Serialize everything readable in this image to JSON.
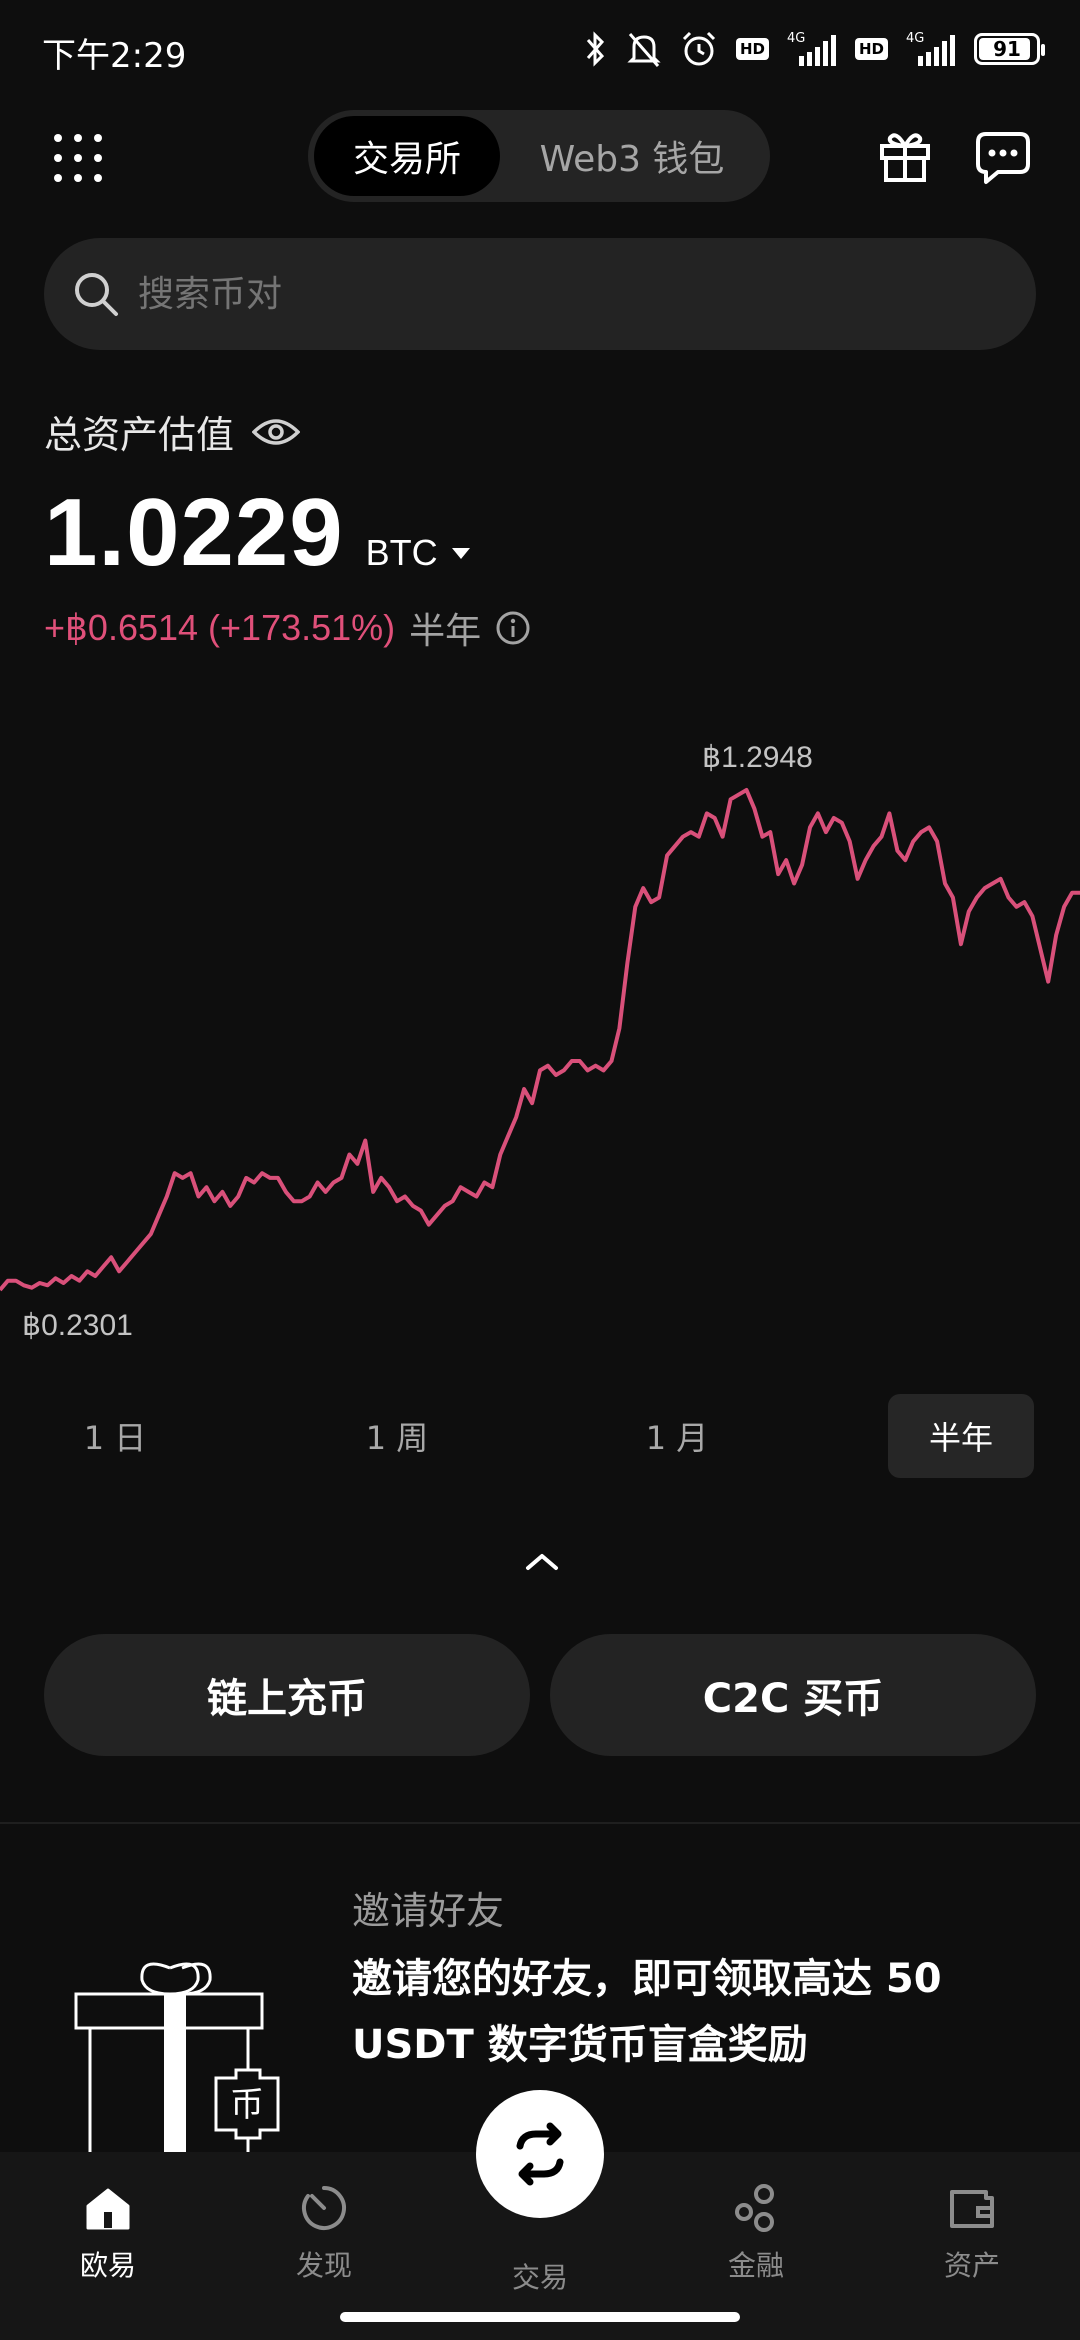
{
  "status_bar": {
    "time": "下午2:29",
    "battery": "91",
    "battery_level_percent": 91,
    "network_1": "4G",
    "network_2": "4G",
    "hd_label": "HD"
  },
  "top_nav": {
    "tabs": [
      {
        "label": "交易所",
        "active": true
      },
      {
        "label": "Web3 钱包",
        "active": false
      }
    ],
    "icons": [
      "menu-grid-icon",
      "gift-icon",
      "chat-icon"
    ]
  },
  "search": {
    "placeholder": "搜索币对"
  },
  "assets": {
    "label": "总资产估值",
    "value": "1.0229",
    "unit": "BTC",
    "change": "+฿0.6514 (+173.51%)",
    "period": "半年"
  },
  "chart_data": {
    "type": "line",
    "title": "",
    "xlabel": "",
    "ylabel": "",
    "max_label": "฿1.2948",
    "min_label": "฿0.2301",
    "color": "#d9507a",
    "series": [
      {
        "values": [
          0.23,
          0.25,
          0.25,
          0.24,
          0.235,
          0.245,
          0.24,
          0.255,
          0.245,
          0.26,
          0.25,
          0.27,
          0.26,
          0.28,
          0.3,
          0.27,
          0.29,
          0.31,
          0.33,
          0.35,
          0.39,
          0.43,
          0.48,
          0.47,
          0.48,
          0.43,
          0.45,
          0.42,
          0.44,
          0.41,
          0.43,
          0.47,
          0.46,
          0.48,
          0.47,
          0.47,
          0.44,
          0.42,
          0.42,
          0.43,
          0.46,
          0.44,
          0.46,
          0.47,
          0.52,
          0.5,
          0.55,
          0.44,
          0.47,
          0.45,
          0.42,
          0.43,
          0.41,
          0.4,
          0.37,
          0.39,
          0.41,
          0.42,
          0.45,
          0.44,
          0.43,
          0.46,
          0.45,
          0.52,
          0.56,
          0.6,
          0.66,
          0.63,
          0.7,
          0.71,
          0.69,
          0.7,
          0.72,
          0.72,
          0.7,
          0.71,
          0.7,
          0.72,
          0.79,
          0.93,
          1.05,
          1.09,
          1.06,
          1.07,
          1.16,
          1.18,
          1.2,
          1.21,
          1.2,
          1.25,
          1.24,
          1.2,
          1.28,
          1.29,
          1.3,
          1.26,
          1.2,
          1.21,
          1.12,
          1.15,
          1.1,
          1.14,
          1.22,
          1.25,
          1.21,
          1.24,
          1.23,
          1.19,
          1.11,
          1.15,
          1.18,
          1.2,
          1.25,
          1.17,
          1.15,
          1.19,
          1.21,
          1.22,
          1.19,
          1.1,
          1.07,
          0.97,
          1.04,
          1.07,
          1.09,
          1.1,
          1.11,
          1.07,
          1.05,
          1.06,
          1.03,
          0.96,
          0.89,
          0.99,
          1.05,
          1.08,
          1.08
        ]
      }
    ]
  },
  "range_tabs": [
    {
      "label": "1 日",
      "active": false
    },
    {
      "label": "1 周",
      "active": false
    },
    {
      "label": "1 月",
      "active": false
    },
    {
      "label": "半年",
      "active": true
    }
  ],
  "actions": {
    "deposit": "链上充币",
    "c2c": "C2C 买币"
  },
  "promo": {
    "kicker": "邀请好友",
    "text": "邀请您的好友，即可领取高达 50 USDT 数字货币盲盒奖励",
    "badge": "币"
  },
  "bottom_nav": [
    {
      "label": "欧易",
      "icon": "home-icon",
      "active": true
    },
    {
      "label": "发现",
      "icon": "discover-icon",
      "active": false
    },
    {
      "label": "交易",
      "icon": "swap-icon",
      "active": false
    },
    {
      "label": "金融",
      "icon": "finance-icon",
      "active": false
    },
    {
      "label": "资产",
      "icon": "wallet-icon",
      "active": false
    }
  ]
}
